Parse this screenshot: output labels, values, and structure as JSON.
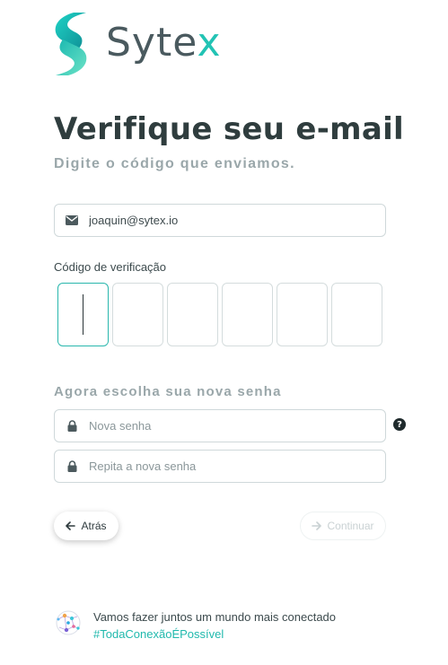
{
  "brand": {
    "name_main": "Syte",
    "name_x": "x",
    "accent": "#22c3b4",
    "text_color": "#4a5a5f"
  },
  "page": {
    "title": "Verifique seu e-mail",
    "subtitle": "Digite o código que enviamos."
  },
  "email_field": {
    "icon": "envelope-icon",
    "value": "joaquin@sytex.io"
  },
  "code": {
    "label": "Código de verificação",
    "digits": [
      "",
      "",
      "",
      "",
      "",
      ""
    ],
    "active_index": 0
  },
  "password": {
    "heading": "Agora escolha sua nova senha",
    "new_placeholder": "Nova senha",
    "repeat_placeholder": "Repita a nova senha",
    "help_glyph": "?"
  },
  "actions": {
    "back_label": "Atrás",
    "continue_label": "Continuar"
  },
  "footer": {
    "line": "Vamos fazer juntos um mundo mais conectado",
    "hashtag": "#TodaConexãoÉPossível"
  }
}
